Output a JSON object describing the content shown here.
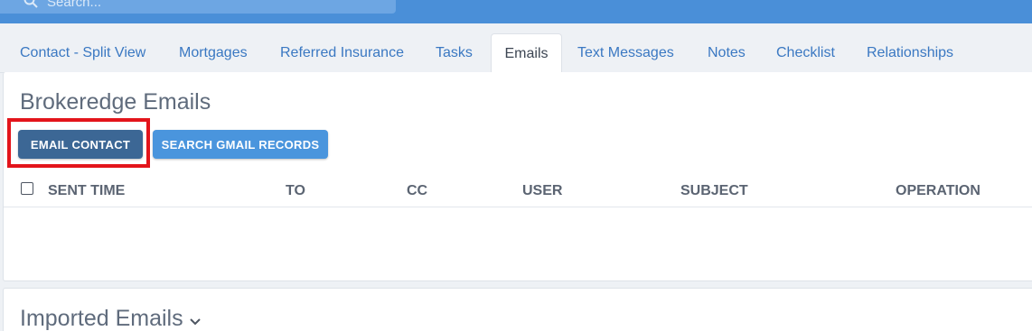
{
  "topbar": {
    "search_placeholder": "Search..."
  },
  "tabs": [
    {
      "label": "Contact - Split View",
      "active": false
    },
    {
      "label": "Mortgages",
      "active": false
    },
    {
      "label": "Referred Insurance",
      "active": false
    },
    {
      "label": "Tasks",
      "active": false
    },
    {
      "label": "Emails",
      "active": true
    },
    {
      "label": "Text Messages",
      "active": false
    },
    {
      "label": "Notes",
      "active": false
    },
    {
      "label": "Checklist",
      "active": false
    },
    {
      "label": "Relationships",
      "active": false
    }
  ],
  "brokeredge": {
    "title": "Brokeredge Emails",
    "email_contact_label": "EMAIL CONTACT",
    "search_gmail_label": "SEARCH GMAIL RECORDS",
    "columns": [
      "SENT TIME",
      "TO",
      "CC",
      "USER",
      "SUBJECT",
      "OPERATION"
    ]
  },
  "imported": {
    "title": "Imported Emails"
  },
  "colors": {
    "topbar": "#4a8fd8",
    "tab_link": "#3a78c2",
    "email_contact_button": "#3c6795",
    "search_gmail_button": "#4a95dd",
    "highlight": "#e3141b"
  }
}
